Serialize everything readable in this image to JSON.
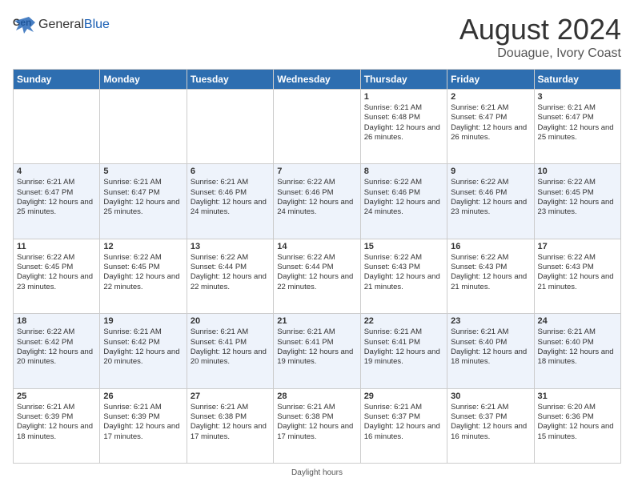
{
  "header": {
    "logo_general": "General",
    "logo_blue": "Blue",
    "main_title": "August 2024",
    "subtitle": "Douague, Ivory Coast"
  },
  "footer": {
    "daylight_hours": "Daylight hours"
  },
  "days_of_week": [
    "Sunday",
    "Monday",
    "Tuesday",
    "Wednesday",
    "Thursday",
    "Friday",
    "Saturday"
  ],
  "weeks": [
    [
      {
        "day": "",
        "details": ""
      },
      {
        "day": "",
        "details": ""
      },
      {
        "day": "",
        "details": ""
      },
      {
        "day": "",
        "details": ""
      },
      {
        "day": "1",
        "details": "Sunrise: 6:21 AM\nSunset: 6:48 PM\nDaylight: 12 hours and 26 minutes."
      },
      {
        "day": "2",
        "details": "Sunrise: 6:21 AM\nSunset: 6:47 PM\nDaylight: 12 hours and 26 minutes."
      },
      {
        "day": "3",
        "details": "Sunrise: 6:21 AM\nSunset: 6:47 PM\nDaylight: 12 hours and 25 minutes."
      }
    ],
    [
      {
        "day": "4",
        "details": "Sunrise: 6:21 AM\nSunset: 6:47 PM\nDaylight: 12 hours and 25 minutes."
      },
      {
        "day": "5",
        "details": "Sunrise: 6:21 AM\nSunset: 6:47 PM\nDaylight: 12 hours and 25 minutes."
      },
      {
        "day": "6",
        "details": "Sunrise: 6:21 AM\nSunset: 6:46 PM\nDaylight: 12 hours and 24 minutes."
      },
      {
        "day": "7",
        "details": "Sunrise: 6:22 AM\nSunset: 6:46 PM\nDaylight: 12 hours and 24 minutes."
      },
      {
        "day": "8",
        "details": "Sunrise: 6:22 AM\nSunset: 6:46 PM\nDaylight: 12 hours and 24 minutes."
      },
      {
        "day": "9",
        "details": "Sunrise: 6:22 AM\nSunset: 6:46 PM\nDaylight: 12 hours and 23 minutes."
      },
      {
        "day": "10",
        "details": "Sunrise: 6:22 AM\nSunset: 6:45 PM\nDaylight: 12 hours and 23 minutes."
      }
    ],
    [
      {
        "day": "11",
        "details": "Sunrise: 6:22 AM\nSunset: 6:45 PM\nDaylight: 12 hours and 23 minutes."
      },
      {
        "day": "12",
        "details": "Sunrise: 6:22 AM\nSunset: 6:45 PM\nDaylight: 12 hours and 22 minutes."
      },
      {
        "day": "13",
        "details": "Sunrise: 6:22 AM\nSunset: 6:44 PM\nDaylight: 12 hours and 22 minutes."
      },
      {
        "day": "14",
        "details": "Sunrise: 6:22 AM\nSunset: 6:44 PM\nDaylight: 12 hours and 22 minutes."
      },
      {
        "day": "15",
        "details": "Sunrise: 6:22 AM\nSunset: 6:43 PM\nDaylight: 12 hours and 21 minutes."
      },
      {
        "day": "16",
        "details": "Sunrise: 6:22 AM\nSunset: 6:43 PM\nDaylight: 12 hours and 21 minutes."
      },
      {
        "day": "17",
        "details": "Sunrise: 6:22 AM\nSunset: 6:43 PM\nDaylight: 12 hours and 21 minutes."
      }
    ],
    [
      {
        "day": "18",
        "details": "Sunrise: 6:22 AM\nSunset: 6:42 PM\nDaylight: 12 hours and 20 minutes."
      },
      {
        "day": "19",
        "details": "Sunrise: 6:21 AM\nSunset: 6:42 PM\nDaylight: 12 hours and 20 minutes."
      },
      {
        "day": "20",
        "details": "Sunrise: 6:21 AM\nSunset: 6:41 PM\nDaylight: 12 hours and 20 minutes."
      },
      {
        "day": "21",
        "details": "Sunrise: 6:21 AM\nSunset: 6:41 PM\nDaylight: 12 hours and 19 minutes."
      },
      {
        "day": "22",
        "details": "Sunrise: 6:21 AM\nSunset: 6:41 PM\nDaylight: 12 hours and 19 minutes."
      },
      {
        "day": "23",
        "details": "Sunrise: 6:21 AM\nSunset: 6:40 PM\nDaylight: 12 hours and 18 minutes."
      },
      {
        "day": "24",
        "details": "Sunrise: 6:21 AM\nSunset: 6:40 PM\nDaylight: 12 hours and 18 minutes."
      }
    ],
    [
      {
        "day": "25",
        "details": "Sunrise: 6:21 AM\nSunset: 6:39 PM\nDaylight: 12 hours and 18 minutes."
      },
      {
        "day": "26",
        "details": "Sunrise: 6:21 AM\nSunset: 6:39 PM\nDaylight: 12 hours and 17 minutes."
      },
      {
        "day": "27",
        "details": "Sunrise: 6:21 AM\nSunset: 6:38 PM\nDaylight: 12 hours and 17 minutes."
      },
      {
        "day": "28",
        "details": "Sunrise: 6:21 AM\nSunset: 6:38 PM\nDaylight: 12 hours and 17 minutes."
      },
      {
        "day": "29",
        "details": "Sunrise: 6:21 AM\nSunset: 6:37 PM\nDaylight: 12 hours and 16 minutes."
      },
      {
        "day": "30",
        "details": "Sunrise: 6:21 AM\nSunset: 6:37 PM\nDaylight: 12 hours and 16 minutes."
      },
      {
        "day": "31",
        "details": "Sunrise: 6:20 AM\nSunset: 6:36 PM\nDaylight: 12 hours and 15 minutes."
      }
    ]
  ]
}
